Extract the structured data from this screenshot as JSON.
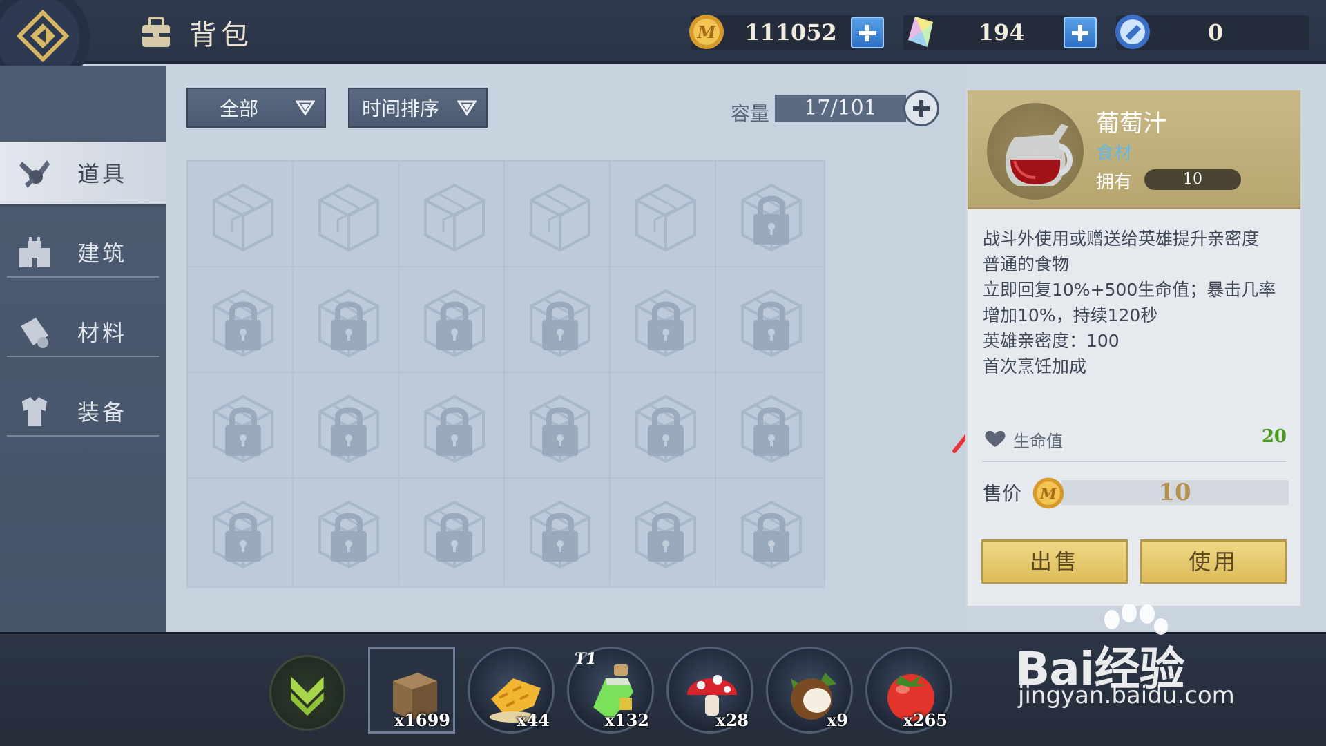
{
  "header": {
    "title": "背包",
    "gold": "111052",
    "crystal": "194",
    "ticket": "0"
  },
  "sidebar": {
    "items": [
      {
        "label": "道具",
        "icon": "tools-icon",
        "active": true
      },
      {
        "label": "建筑",
        "icon": "castle-icon",
        "active": false
      },
      {
        "label": "材料",
        "icon": "scroll-icon",
        "active": false
      },
      {
        "label": "装备",
        "icon": "armor-icon",
        "active": false
      }
    ]
  },
  "filters": {
    "category": "全部",
    "sort": "时间排序",
    "capacity_label": "容量",
    "capacity": "17/101"
  },
  "detail": {
    "name": "葡萄汁",
    "type": "食材",
    "own_label": "拥有",
    "own_count": "10",
    "desc": [
      "战斗外使用或赠送给英雄提升亲密度",
      "普通的食物",
      "立即回复10%+500生命值；暴击几率增加10%，持续120秒",
      "英雄亲密度：100",
      "首次烹饪加成"
    ],
    "stat_label": "生命值",
    "stat_value": "20",
    "price_label": "售价",
    "price": "10",
    "sell_label": "出售",
    "use_label": "使用"
  },
  "quickbar": [
    {
      "icon": "wood-block-icon",
      "count": "x1699",
      "tier": ""
    },
    {
      "icon": "honeycomb-icon",
      "count": "x44",
      "tier": ""
    },
    {
      "icon": "potion-icon",
      "count": "x132",
      "tier": "T1"
    },
    {
      "icon": "mushroom-icon",
      "count": "x28",
      "tier": ""
    },
    {
      "icon": "coconut-icon",
      "count": "x9",
      "tier": ""
    },
    {
      "icon": "tomato-icon",
      "count": "x265",
      "tier": ""
    }
  ],
  "watermark": {
    "top": "Bai经验",
    "bottom": "jingyan.baidu.com"
  },
  "colors": {
    "topbar": "#2f3a4f",
    "sidebar": "#4e5c73",
    "main_bg": "#c6d2de",
    "detail_head": "#c9b987",
    "button_gold": "#e8cc73",
    "arrow": "#e8353a",
    "stat_green": "#4a9a1e"
  }
}
